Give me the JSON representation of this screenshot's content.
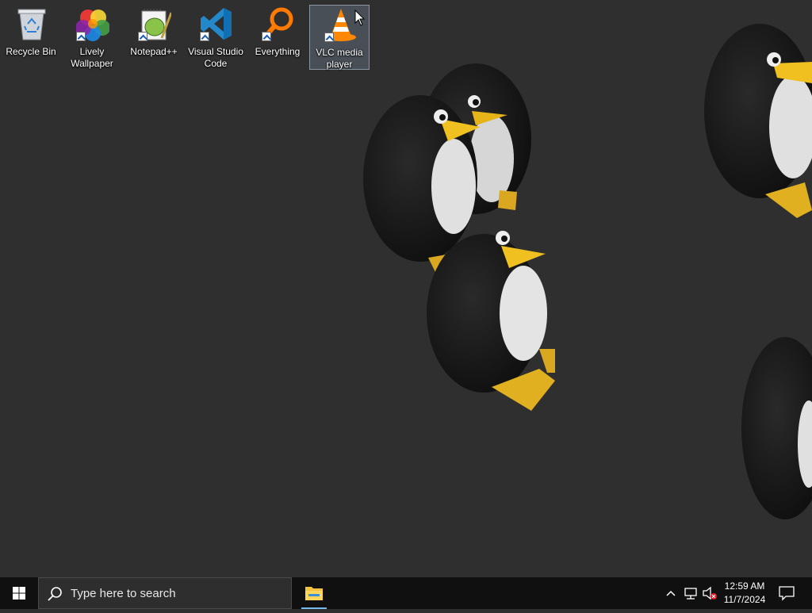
{
  "desktop": {
    "icons": [
      {
        "label": "Recycle Bin"
      },
      {
        "label": "Lively Wallpaper"
      },
      {
        "label": "Notepad++"
      },
      {
        "label": "Visual Studio Code"
      },
      {
        "label": "Everything"
      },
      {
        "label": "VLC media player"
      }
    ],
    "selected_icon": "VLC media player"
  },
  "taskbar": {
    "search_placeholder": "Type here to search",
    "pinned": [
      "File Explorer"
    ],
    "tray": {
      "icons": [
        "chevron-up-icon",
        "network-icon",
        "volume-muted-icon"
      ],
      "time": "12:59 AM",
      "date": "11/7/2024"
    }
  },
  "colors": {
    "desktop_bg": "#2f2f2f",
    "taskbar_bg": "#101010",
    "search_bg": "#2e2e2e",
    "accent": "#76b9ed"
  }
}
